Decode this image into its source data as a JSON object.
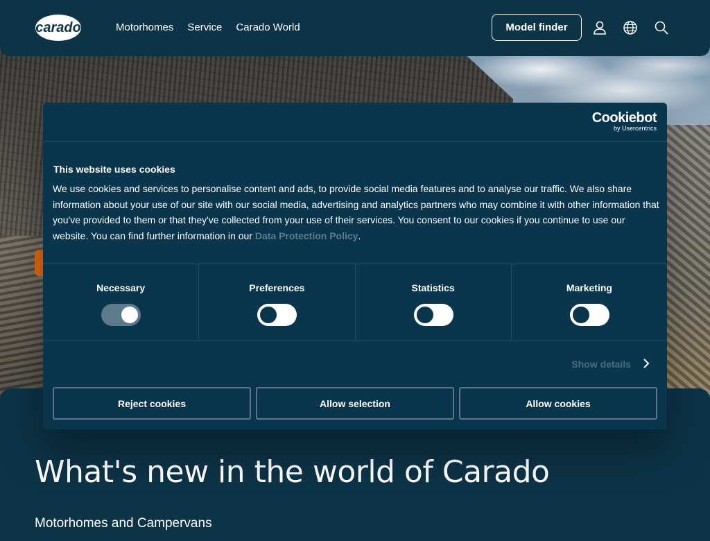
{
  "header": {
    "logo_text": "carado",
    "nav": [
      "Motorhomes",
      "Service",
      "Carado World"
    ],
    "model_finder_label": "Model finder",
    "icons": [
      "user-icon",
      "globe-icon",
      "search-icon"
    ]
  },
  "section": {
    "title": "What's new in the world of Carado",
    "subtitle": "Motorhomes and Campervans"
  },
  "cookie_dialog": {
    "brand": "Cookiebot",
    "brand_sub": "by Usercentrics",
    "title": "This website uses cookies",
    "body_text": "We use cookies and services to personalise content and ads, to provide social media features and to analyse our traffic. We also share information about your use of our site with our social media, advertising and analytics partners who may combine it with other information that you've provided to them or that they've collected from your use of their services. You consent to our cookies if you continue to use our website. You can find further information in our ",
    "link_text": "Data Protection Policy",
    "body_end": ".",
    "categories": [
      {
        "label": "Necessary",
        "state": "on"
      },
      {
        "label": "Preferences",
        "state": "off"
      },
      {
        "label": "Statistics",
        "state": "off"
      },
      {
        "label": "Marketing",
        "state": "off"
      }
    ],
    "show_details": "Show details",
    "buttons": {
      "reject": "Reject cookies",
      "selection": "Allow selection",
      "allow": "Allow cookies"
    }
  },
  "colors": {
    "primary_bg": "#0d3347",
    "dialog_bg": "#0a364d",
    "accent_orange": "#e36a12"
  }
}
